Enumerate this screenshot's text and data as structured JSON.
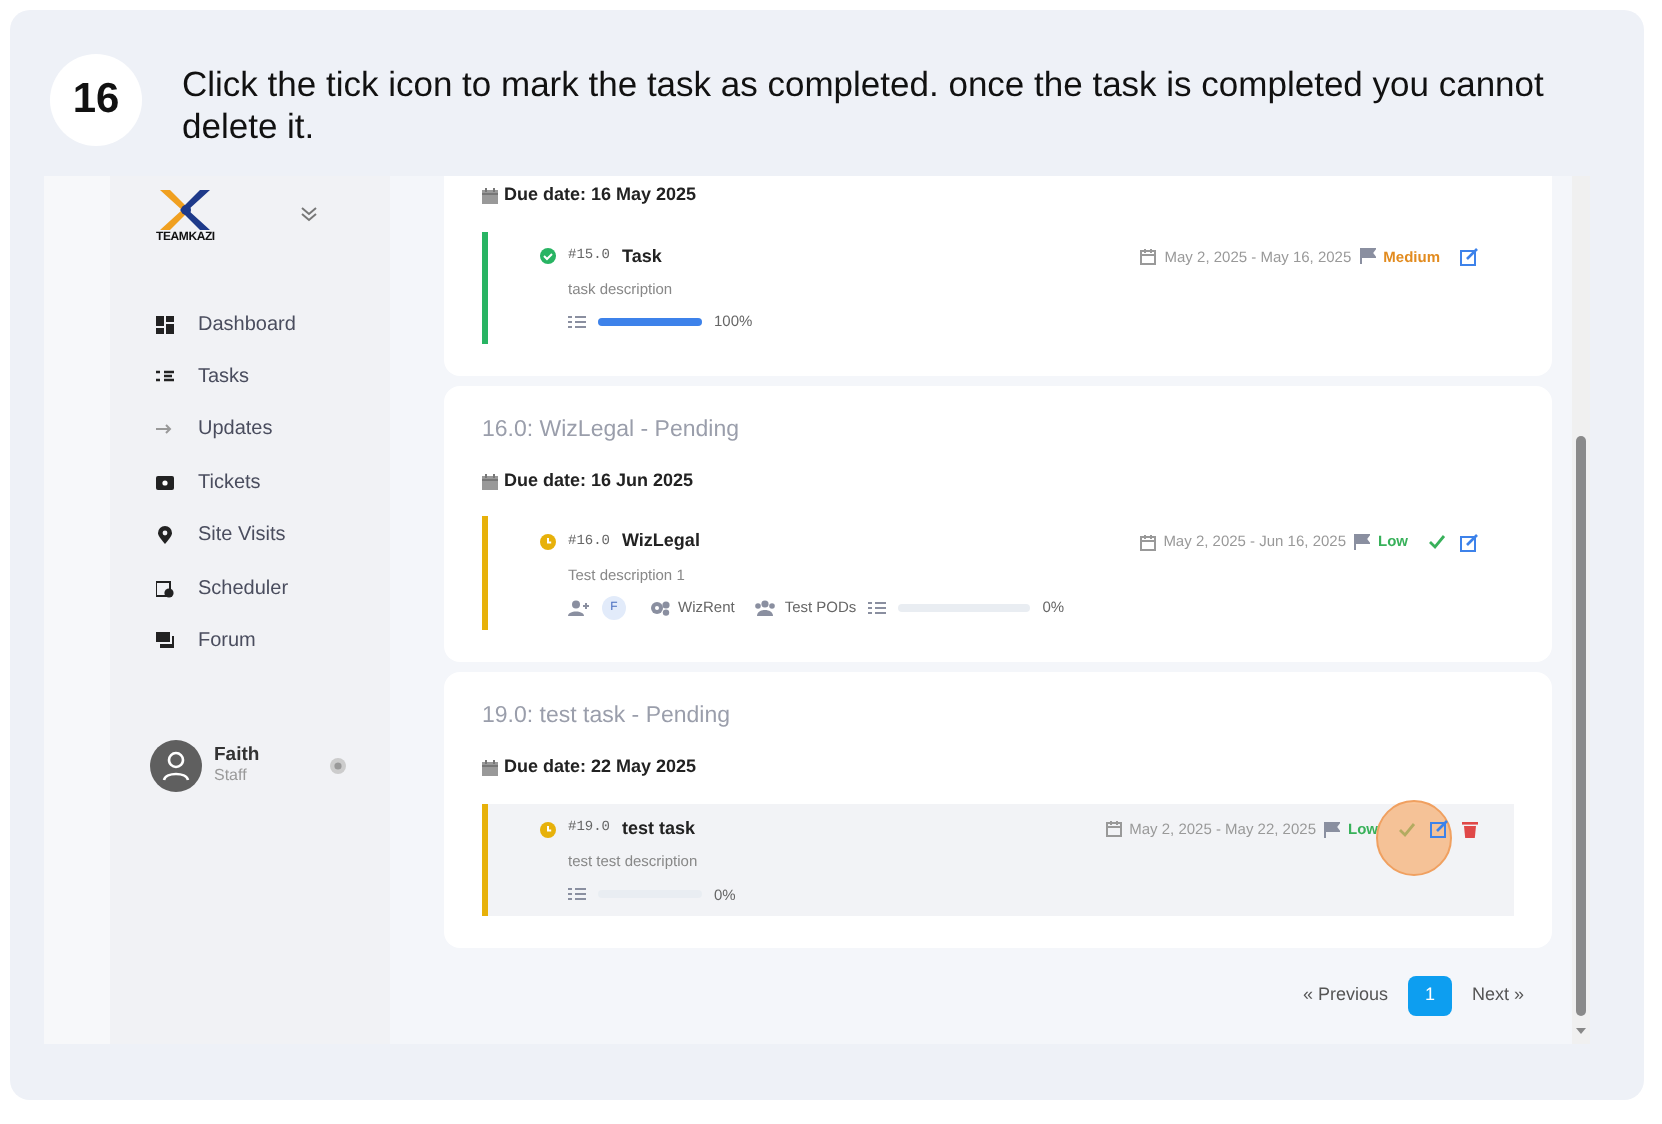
{
  "step": {
    "number": "16",
    "text": "Click the tick icon to mark the task as completed. once the task is completed you cannot delete it."
  },
  "sidebar": {
    "brand": "TEAMKAZI",
    "items": [
      {
        "label": "Dashboard",
        "kind": "dashboard"
      },
      {
        "label": "Tasks",
        "kind": "tasks"
      },
      {
        "label": "Updates",
        "kind": "updates"
      },
      {
        "label": "Tickets",
        "kind": "tickets"
      },
      {
        "label": "Site Visits",
        "kind": "pin"
      },
      {
        "label": "Scheduler",
        "kind": "scheduler"
      },
      {
        "label": "Forum",
        "kind": "forum"
      }
    ],
    "user": {
      "name": "Faith",
      "role": "Staff"
    }
  },
  "tasks": [
    {
      "due_date": "Due date: 16 May 2025",
      "item": {
        "kind": "completed",
        "number": "#15.0",
        "title": "Task",
        "description": "task description",
        "dates": "May 2, 2025 - May 16, 2025",
        "priority": "Medium",
        "color": "#e28b1f",
        "can_complete": false,
        "can_delete": false,
        "hovered": false,
        "click_marker": false,
        "progress": {
          "level": 1,
          "text": "100%"
        }
      }
    },
    {
      "heading": "16.0: WizLegal - Pending",
      "due_date": "Due date: 16 Jun 2025",
      "item": {
        "kind": "pending",
        "number": "#16.0",
        "title": "WizLegal",
        "description": "Test description 1",
        "dates": "May 2, 2025 - Jun 16, 2025",
        "priority": "Low",
        "color": "#38b15a",
        "can_complete": true,
        "can_delete": false,
        "hovered": false,
        "click_marker": false,
        "assignee": "F",
        "project": "WizRent",
        "team": "Test PODs",
        "progress": {
          "level": 0,
          "text": "0%"
        }
      }
    },
    {
      "heading": "19.0: test task - Pending",
      "due_date": "Due date: 22 May 2025",
      "item": {
        "kind": "pending",
        "number": "#19.0",
        "title": "test task",
        "description": "test test description",
        "dates": "May 2, 2025 - May 22, 2025",
        "priority": "Low",
        "color": "#38b15a",
        "can_complete": true,
        "can_delete": true,
        "hovered": true,
        "click_marker": true,
        "progress": {
          "level": 0,
          "text": "0%"
        }
      }
    }
  ],
  "pagination": {
    "previous": "« Previous",
    "pages": [
      {
        "label": "1",
        "selected": true
      }
    ],
    "next": "Next »"
  }
}
